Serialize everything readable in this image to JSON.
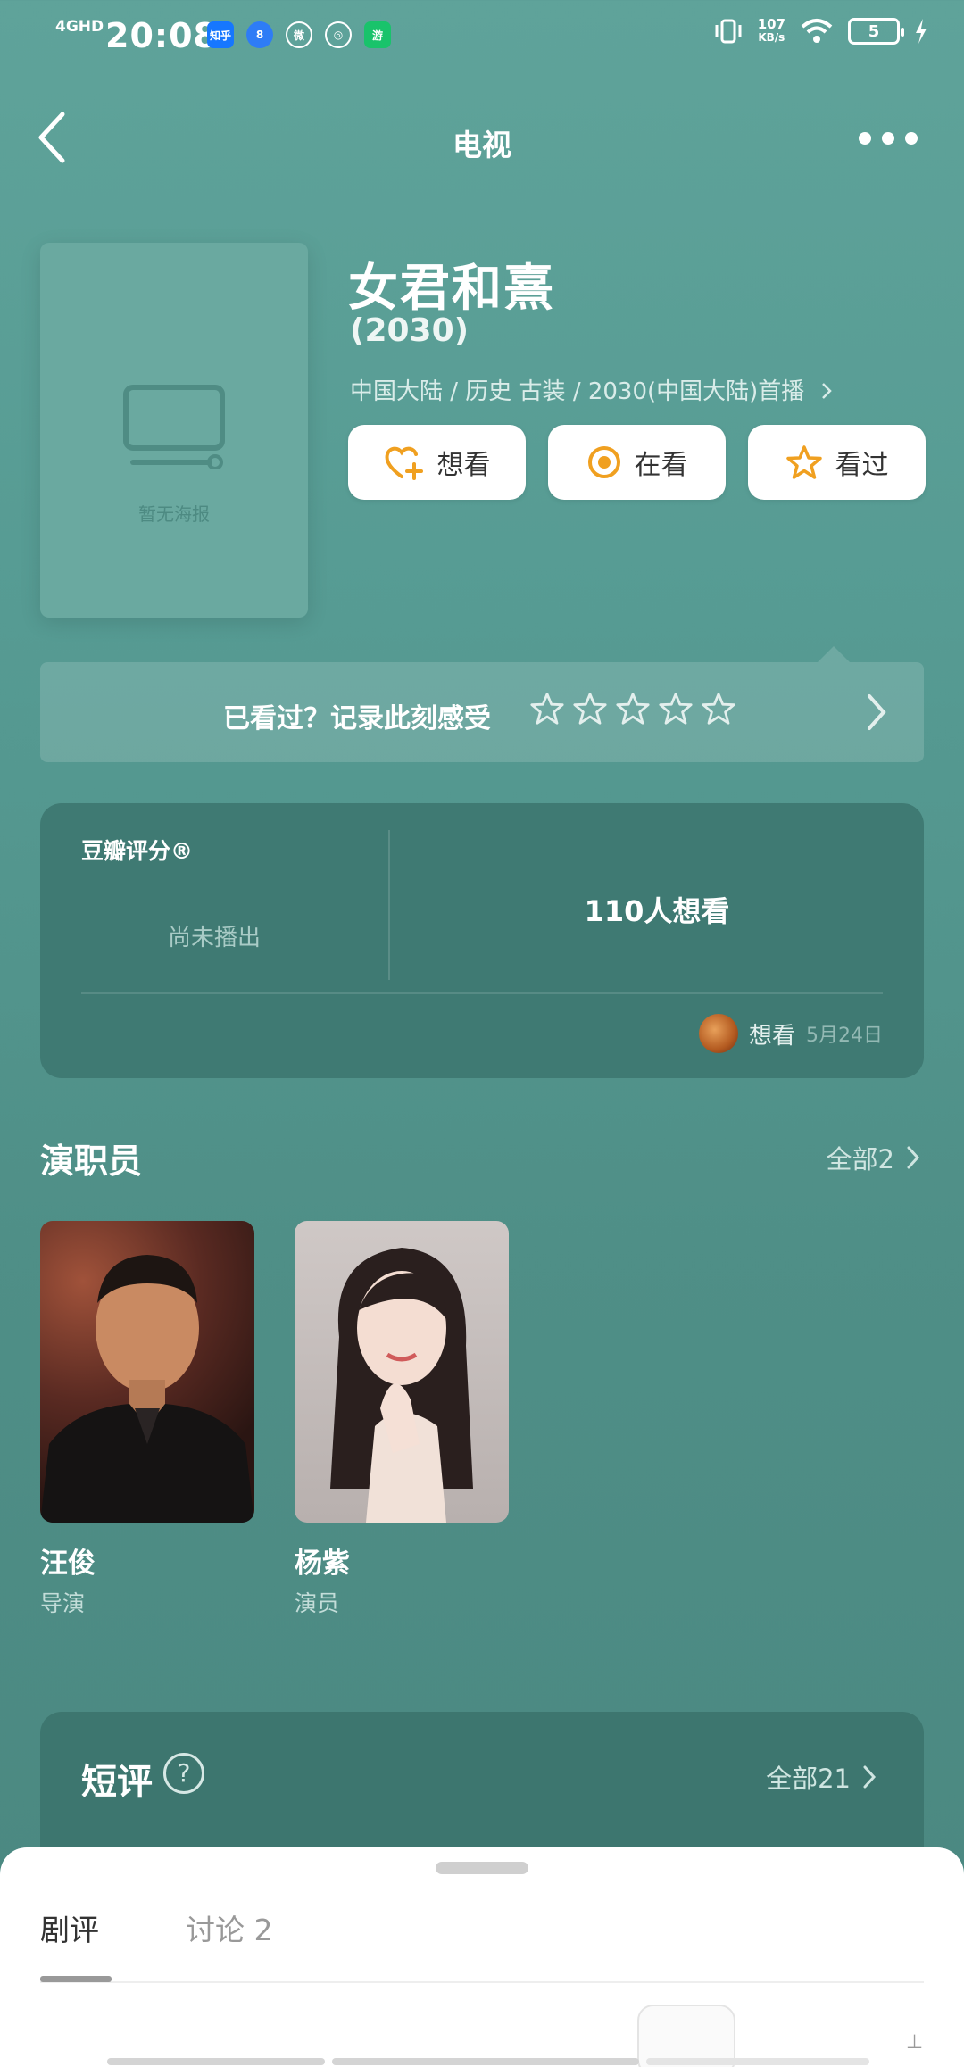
{
  "status_bar": {
    "network": "4GHD",
    "time": "20:08",
    "apps": [
      "知乎",
      "8",
      "微",
      "◎",
      "游"
    ],
    "speed_value": "107",
    "speed_unit": "KB/s",
    "battery": "5"
  },
  "nav": {
    "back_icon": "chevron-left-icon",
    "title": "电视",
    "more_icon": "more-dots-icon"
  },
  "poster": {
    "placeholder_text": "暂无海报"
  },
  "show": {
    "title": "女君和熹",
    "year": "(2030)",
    "meta": "中国大陆 / 历史 古装 / 2030(中国大陆)首播"
  },
  "status_buttons": [
    {
      "label": "想看",
      "icon": "heart-plus-icon"
    },
    {
      "label": "在看",
      "icon": "target-icon"
    },
    {
      "label": "看过",
      "icon": "star-icon"
    }
  ],
  "record": {
    "prompt": "已看过？记录此刻感受",
    "stars": 5
  },
  "score": {
    "label": "豆瓣评分®",
    "status": "尚未播出",
    "want_count": "110人想看",
    "recent_action": "想看",
    "recent_date": "5月24日"
  },
  "cast_section": {
    "title": "演职员",
    "all_link": "全部2",
    "members": [
      {
        "name": "汪俊",
        "role": "导演"
      },
      {
        "name": "杨紫",
        "role": "演员"
      }
    ]
  },
  "reviews": {
    "title": "短评",
    "help_icon": "?",
    "all_link": "全部21"
  },
  "sheet": {
    "tabs": [
      "剧评",
      "讨论 2"
    ],
    "corner_text": "⊥"
  },
  "colors": {
    "accent": "#f0a020",
    "background": "#569b93",
    "card": "#3f7a73"
  }
}
